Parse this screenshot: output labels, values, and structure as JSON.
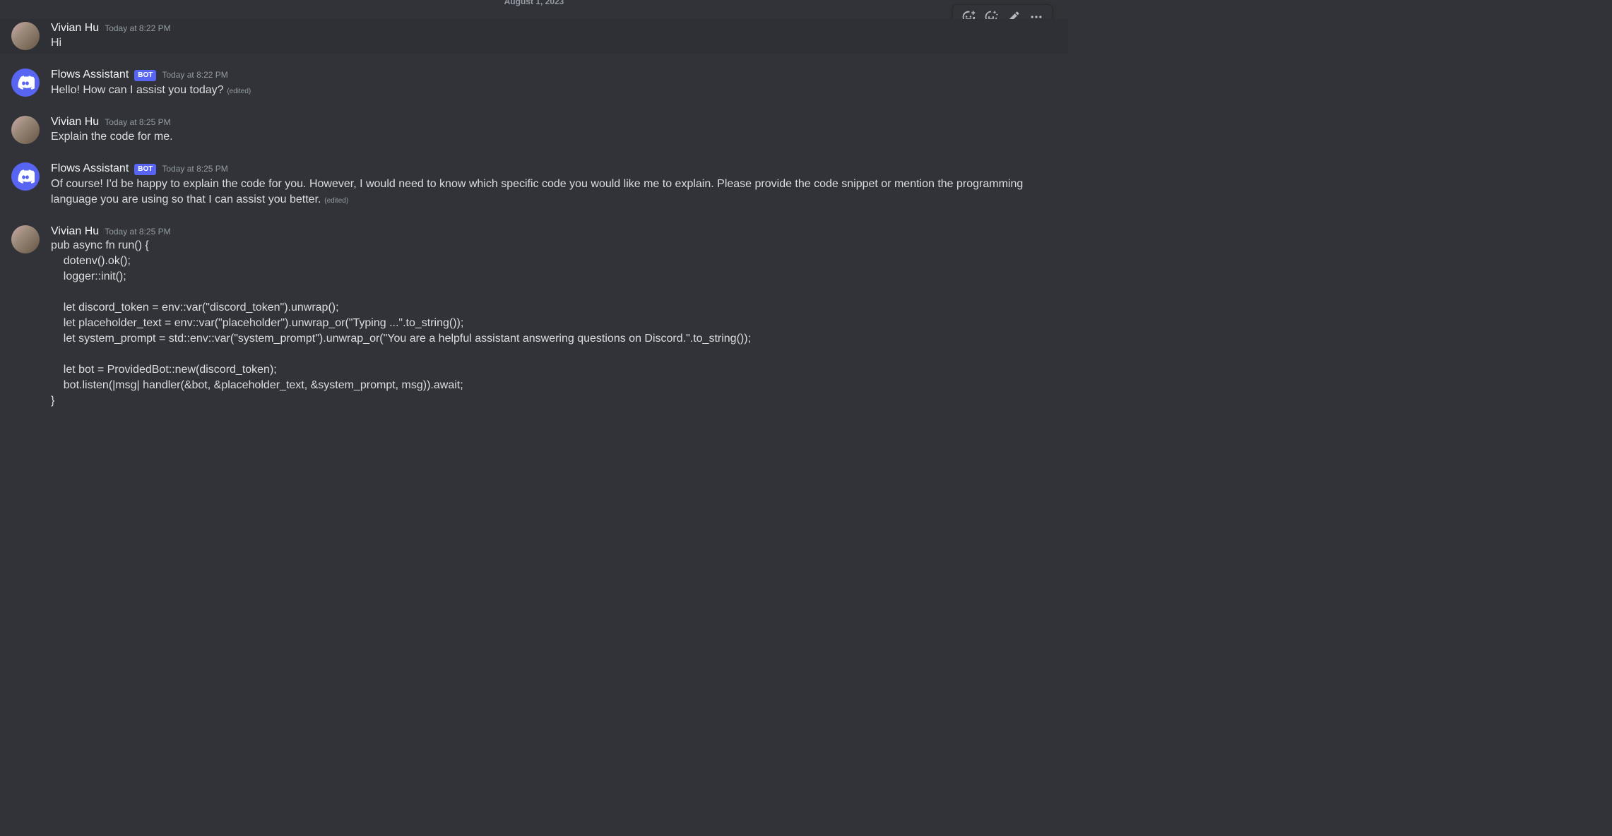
{
  "dateDivider": "August 1, 2023",
  "editedLabel": "(edited)",
  "botTag": "BOT",
  "messages": [
    {
      "author": "Vivian Hu",
      "isBot": false,
      "timestamp": "Today at 8:22 PM",
      "hovered": true,
      "lines": [
        "Hi"
      ],
      "edited": false
    },
    {
      "author": "Flows Assistant",
      "isBot": true,
      "timestamp": "Today at 8:22 PM",
      "hovered": false,
      "lines": [
        "Hello! How can I assist you today?"
      ],
      "edited": true
    },
    {
      "author": "Vivian Hu",
      "isBot": false,
      "timestamp": "Today at 8:25 PM",
      "hovered": false,
      "lines": [
        "Explain the code for me."
      ],
      "edited": false
    },
    {
      "author": "Flows Assistant",
      "isBot": true,
      "timestamp": "Today at 8:25 PM",
      "hovered": false,
      "lines": [
        "Of course! I'd be happy to explain the code for you. However, I would need to know which specific code you would like me to explain. Please provide the code snippet or mention the programming language you are using so that I can assist you better."
      ],
      "edited": true
    },
    {
      "author": "Vivian Hu",
      "isBot": false,
      "timestamp": "Today at 8:25 PM",
      "hovered": false,
      "code": "pub async fn run() {\n    dotenv().ok();\n    logger::init();\n\n    let discord_token = env::var(\"discord_token\").unwrap();\n    let placeholder_text = env::var(\"placeholder\").unwrap_or(\"Typing ...\".to_string());\n    let system_prompt = std::env::var(\"system_prompt\").unwrap_or(\"You are a helpful assistant answering questions on Discord.\".to_string());\n\n    let bot = ProvidedBot::new(discord_token);\n    bot.listen(|msg| handler(&bot, &placeholder_text, &system_prompt, msg)).await;\n}",
      "edited": false
    }
  ]
}
